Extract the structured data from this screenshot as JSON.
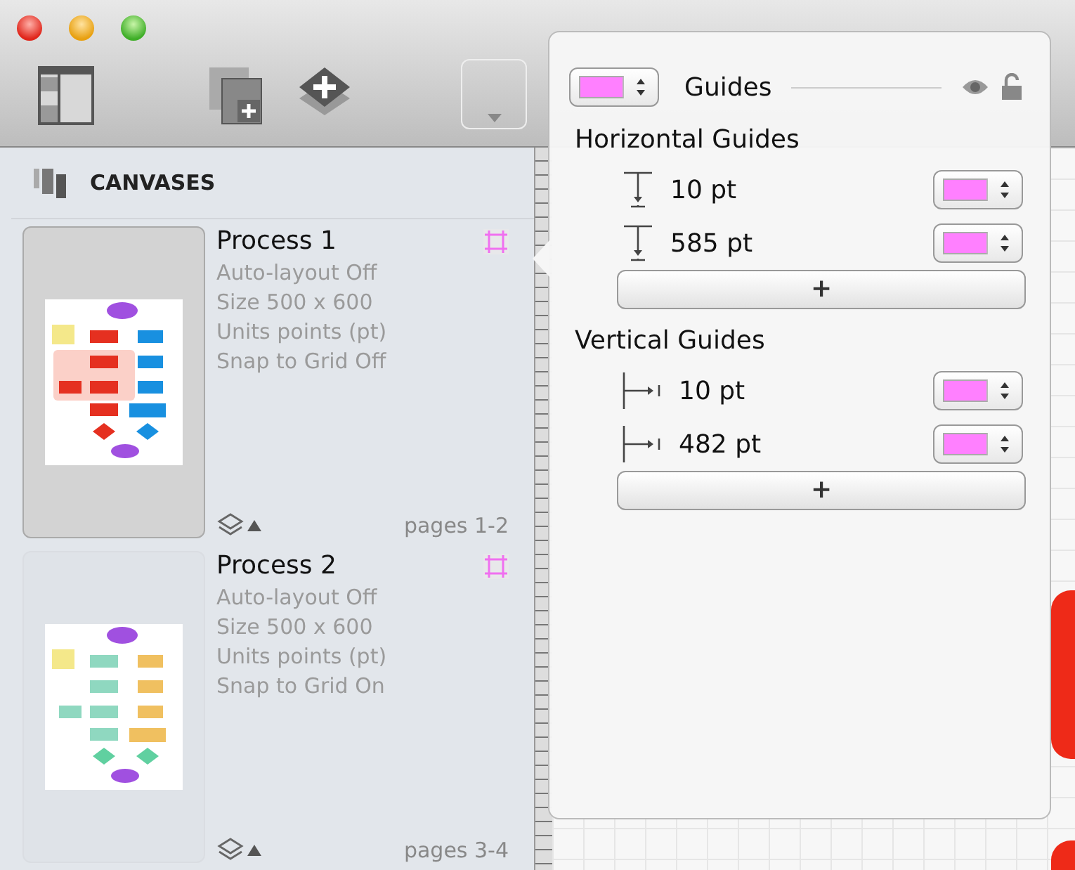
{
  "sidebar": {
    "title": "CANVASES",
    "canvases": [
      {
        "name": "Process 1",
        "selected": true,
        "details": [
          "Auto-layout Off",
          "Size 500 x 600",
          "Units points (pt)",
          "Snap to Grid Off"
        ],
        "pages": "pages 1-2"
      },
      {
        "name": "Process 2",
        "selected": false,
        "details": [
          "Auto-layout Off",
          "Size 500 x 600",
          "Units points (pt)",
          "Snap to Grid On"
        ],
        "pages": "pages 3-4"
      }
    ]
  },
  "popover": {
    "title": "Guides",
    "sections": [
      {
        "kind": "horizontal",
        "heading": "Horizontal Guides",
        "guides": [
          "10 pt",
          "585 pt"
        ],
        "add": "+"
      },
      {
        "kind": "vertical",
        "heading": "Vertical Guides",
        "guides": [
          "10 pt",
          "482 pt"
        ],
        "add": "+"
      }
    ]
  }
}
